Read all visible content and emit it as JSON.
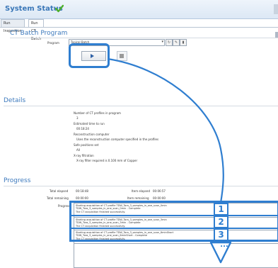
{
  "header": {
    "title": "System Status"
  },
  "tabs": [
    {
      "label": "Run Inspection"
    },
    {
      "label": "Run CT Batch"
    }
  ],
  "ct_batch": {
    "title": "CT Batch Program",
    "program_label": "Program",
    "program_value": "Typical Batch"
  },
  "details": {
    "title": "Details",
    "rows": [
      "Number of CT profiles in program",
      "3",
      "Estimated time to run",
      "00:18:24",
      "Reconstruction computer",
      "Uses the reconstruction computer specified in the profiles",
      "Safe positions set",
      "All",
      "X-ray filtration",
      "X-ray filter required is 0.100 mm of Copper"
    ]
  },
  "progress": {
    "title": "Progress",
    "total_elapsed_label": "Total elapsed",
    "total_elapsed_value": "00:18:48",
    "item_elapsed_label": "Item elapsed",
    "item_elapsed_value": "00:06:57",
    "total_remaining_label": "Total remaining",
    "total_remaining_value": "00:00:00",
    "item_remaining_label": "Item remaining",
    "item_remaining_value": "00:00:00",
    "progress_label": "Progress",
    "log": [
      {
        "line1": "Starting acquisition of CT profile TDW_Tora_3_samples_in_one_scan_0min",
        "line2": "TDW_Tora_3_samples_in_one_scan_0min - Complete",
        "line3": "The CT acquisition finished successfully."
      },
      {
        "line1": "Starting acquisition of CT profile TDW_Tora_3_samples_in_one_scan_3min",
        "line2": "TDW_Tora_3_samples_in_one_scan_3min - Complete",
        "line3": "The CT acquisition finished successfully."
      },
      {
        "line1": "Starting acquisition of CT profile TDW_Tora_3_samples_in_one_scan_6minShort",
        "line2": "TDW_Tora_3_samples_in_one_scan_6minShort - Complete",
        "line3": "The CT acquisition finished successfully."
      }
    ],
    "markers": [
      "1",
      "2",
      "3",
      "..."
    ]
  },
  "colors": {
    "accent": "#2f7ed0",
    "title_blue": "#3d7abd",
    "check_green": "#4caf2a"
  }
}
